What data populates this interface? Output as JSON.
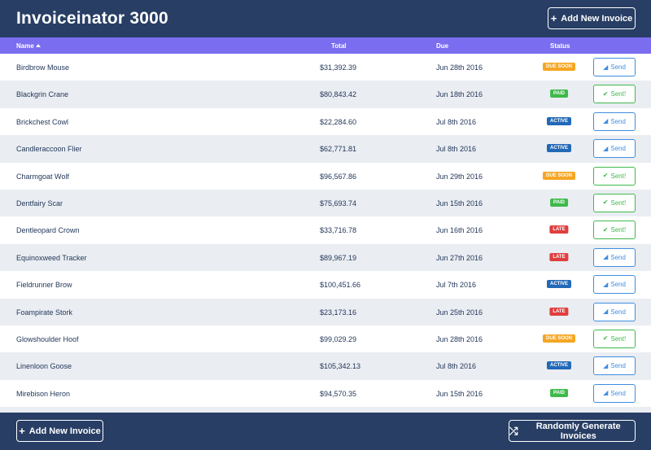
{
  "header": {
    "title": "Invoiceinator 3000",
    "add_button_label": "Add New Invoice",
    "add_button_icon": "plus-icon"
  },
  "table": {
    "columns": {
      "name": "Name",
      "total": "Total",
      "due": "Due",
      "status": "Status"
    },
    "sort": {
      "column": "Name",
      "direction": "ascending"
    },
    "rows": [
      {
        "name": "Birdbrow Mouse",
        "total": "$31,392.39",
        "due": "Jun 28th 2016",
        "status": "DUE SOON",
        "status_key": "due-soon",
        "action": "Send",
        "action_key": "send"
      },
      {
        "name": "Blackgrin Crane",
        "total": "$80,843.42",
        "due": "Jun 18th 2016",
        "status": "PAID",
        "status_key": "paid",
        "action": "Sent!",
        "action_key": "sent"
      },
      {
        "name": "Brickchest Cowl",
        "total": "$22,284.60",
        "due": "Jul 8th 2016",
        "status": "ACTIVE",
        "status_key": "active",
        "action": "Send",
        "action_key": "send"
      },
      {
        "name": "Candleraccoon Flier",
        "total": "$62,771.81",
        "due": "Jul 8th 2016",
        "status": "ACTIVE",
        "status_key": "active",
        "action": "Send",
        "action_key": "send"
      },
      {
        "name": "Charmgoat Wolf",
        "total": "$96,567.86",
        "due": "Jun 29th 2016",
        "status": "DUE SOON",
        "status_key": "due-soon",
        "action": "Sent!",
        "action_key": "sent"
      },
      {
        "name": "Dentfairy Scar",
        "total": "$75,693.74",
        "due": "Jun 15th 2016",
        "status": "PAID",
        "status_key": "paid",
        "action": "Sent!",
        "action_key": "sent"
      },
      {
        "name": "Dentleopard Crown",
        "total": "$33,716.78",
        "due": "Jun 16th 2016",
        "status": "LATE",
        "status_key": "late",
        "action": "Sent!",
        "action_key": "sent"
      },
      {
        "name": "Equinoxweed Tracker",
        "total": "$89,967.19",
        "due": "Jun 27th 2016",
        "status": "LATE",
        "status_key": "late",
        "action": "Send",
        "action_key": "send"
      },
      {
        "name": "Fieldrunner Brow",
        "total": "$100,451.66",
        "due": "Jul 7th 2016",
        "status": "ACTIVE",
        "status_key": "active",
        "action": "Send",
        "action_key": "send"
      },
      {
        "name": "Foampirate Stork",
        "total": "$23,173.16",
        "due": "Jun 25th 2016",
        "status": "LATE",
        "status_key": "late",
        "action": "Send",
        "action_key": "send"
      },
      {
        "name": "Glowshoulder Hoof",
        "total": "$99,029.29",
        "due": "Jun 28th 2016",
        "status": "DUE SOON",
        "status_key": "due-soon",
        "action": "Sent!",
        "action_key": "sent"
      },
      {
        "name": "Linenloon Goose",
        "total": "$105,342.13",
        "due": "Jul 8th 2016",
        "status": "ACTIVE",
        "status_key": "active",
        "action": "Send",
        "action_key": "send"
      },
      {
        "name": "Mirebison Heron",
        "total": "$94,570.35",
        "due": "Jun 15th 2016",
        "status": "PAID",
        "status_key": "paid",
        "action": "Send",
        "action_key": "send"
      },
      {
        "name": "",
        "total": "",
        "due": "",
        "status": "",
        "status_key": "",
        "action": "",
        "action_key": ""
      }
    ]
  },
  "footer": {
    "add_button_label": "Add New Invoice",
    "add_button_icon": "plus-icon",
    "generate_button_label": "Randomly Generate Invoices",
    "generate_button_icon": "shuffle-icon"
  },
  "colors": {
    "navy": "#283e64",
    "header_purple": "#7a6df0",
    "due_soon": "#f5a623",
    "paid": "#3fb94b",
    "active": "#2269b8",
    "late": "#e03e3e",
    "send_blue": "#3f8ee0"
  }
}
